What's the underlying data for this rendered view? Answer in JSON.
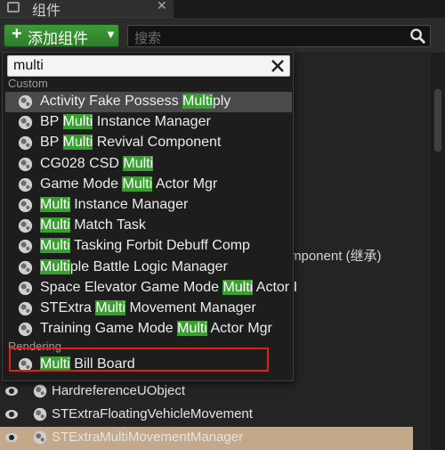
{
  "window": {
    "tab_title": "组件"
  },
  "toolbar": {
    "add_button_label": "添加组件",
    "search_placeholder": "搜索"
  },
  "popup": {
    "filter_value": "multi",
    "sections": [
      {
        "category": "Custom",
        "items": [
          {
            "label": "Activity Fake Possess Multiply",
            "highlighted": true
          },
          {
            "label": "BP Multi Instance Manager"
          },
          {
            "label": "BP Multi Revival Component"
          },
          {
            "label": "CG028 CSD Multi"
          },
          {
            "label": "Game Mode Multi Actor Mgr"
          },
          {
            "label": "Multi Instance Manager"
          },
          {
            "label": "Multi Match Task"
          },
          {
            "label": "Multi Tasking Forbit Debuff Comp"
          },
          {
            "label": "Multiple Battle Logic Manager"
          },
          {
            "label": "Space Elevator Game Mode Multi Actor I"
          },
          {
            "label": "STExtra Multi Movement Manager",
            "boxed": true
          },
          {
            "label": "Training Game Mode Multi Actor Mgr"
          }
        ]
      },
      {
        "category": "Rendering",
        "items": [
          {
            "label": "Multi Bill Board"
          }
        ]
      }
    ],
    "match_highlight_color": "#37a02e",
    "box_color": "#e01e1e"
  },
  "background": {
    "partial_text": "mponent (继承)",
    "rows": [
      {
        "name": "HardreferenceUObject"
      },
      {
        "name": "STExtraFloatingVehicleMovement"
      },
      {
        "name": "STExtraMultiMovementManager",
        "selected": true
      }
    ]
  }
}
